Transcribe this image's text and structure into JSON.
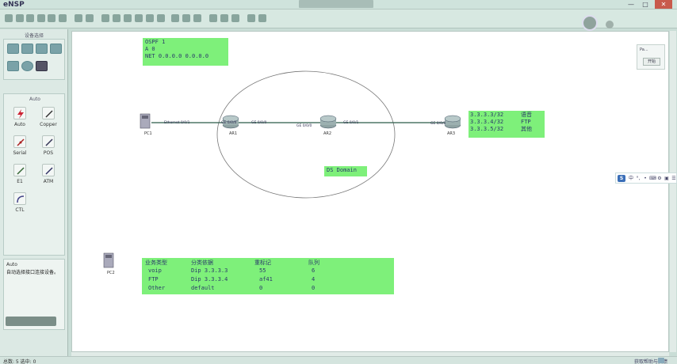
{
  "window": {
    "app_title": "eNSP",
    "center_title": "",
    "min_glyph": "—",
    "max_glyph": "□",
    "close_glyph": "✕"
  },
  "left_panel": {
    "title": "设备选择",
    "cable_title": "Auto",
    "cables": [
      {
        "label": "Auto",
        "icon": "lightning-icon"
      },
      {
        "label": "Copper",
        "icon": "copper-cable-icon"
      },
      {
        "label": "Serial",
        "icon": "serial-cable-icon"
      },
      {
        "label": "POS",
        "icon": "pos-cable-icon"
      },
      {
        "label": "E1",
        "icon": "e1-cable-icon"
      },
      {
        "label": "ATM",
        "icon": "atm-cable-icon"
      },
      {
        "label": "CTL",
        "icon": "ctl-cable-icon"
      }
    ],
    "desc_title": "Auto",
    "desc_text": "自动选择接口连接设备。"
  },
  "notes": {
    "ospf": [
      "OSPF 1",
      "A 0",
      "NET 0.0.0.0 0.0.0.0"
    ],
    "addresses": [
      {
        "ip": "3.3.3.3/32",
        "service": "语音"
      },
      {
        "ip": "3.3.3.4/32",
        "service": "FTP"
      },
      {
        "ip": "3.3.3.5/32",
        "service": "其他"
      }
    ],
    "ds_domain": "DS Domain"
  },
  "qos_table": {
    "headers": [
      "业务类型",
      "分类依据",
      "重标记",
      "队列"
    ],
    "rows": [
      [
        "voip",
        "Dip 3.3.3.3",
        "55",
        "6"
      ],
      [
        "FTP",
        "Dip 3.3.3.4",
        "af41",
        "4"
      ],
      [
        "Other",
        "default",
        "0",
        "0"
      ]
    ]
  },
  "devices": {
    "pc1": "PC1",
    "pc2": "PC2",
    "ar1": "AR1",
    "ar2": "AR2",
    "ar3": "AR3"
  },
  "ports": {
    "pc1_eth": "Ethernet 0/0/1",
    "ar1_left": "GE 0/0/0",
    "ar1_right": "GE 0/0/0",
    "ar2_left": "GE 0/0/0",
    "ar2_right": "GE 0/0/1",
    "ar3_left": "GE 0/0/0"
  },
  "mini_panel": {
    "label": "Pa...",
    "start": "开始"
  },
  "ime": {
    "logo": "S",
    "items": [
      "中",
      "°,",
      "•",
      "⌨",
      "⚙",
      "▣",
      "☰"
    ]
  },
  "statusbar": {
    "left": "总数: 5  选中: 0",
    "right": "获取帮助与反馈"
  },
  "colors": {
    "note_bg": "#7ef07a",
    "canvas_bg": "#ffffff",
    "link": "#2b5a48"
  }
}
